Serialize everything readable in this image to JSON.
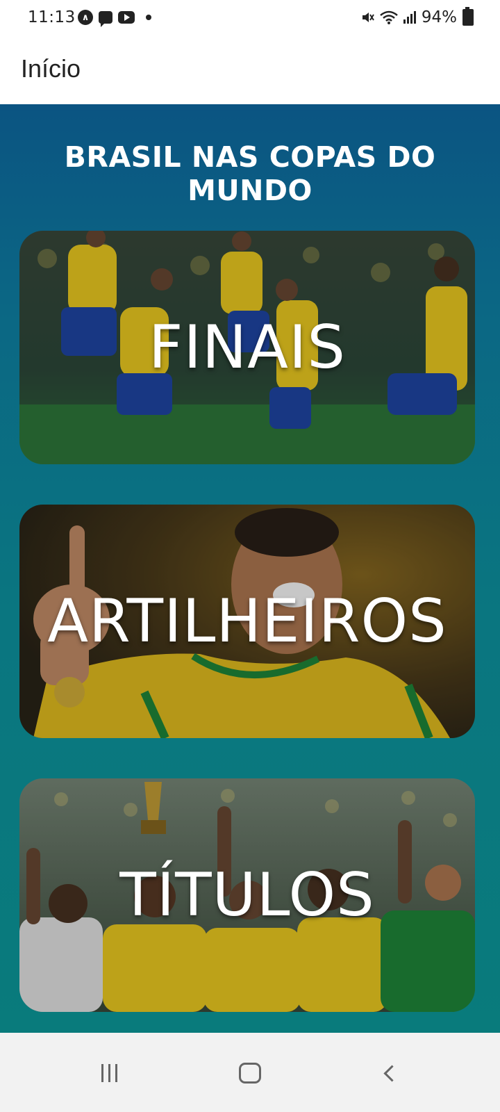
{
  "status_bar": {
    "time": "11:13",
    "notification_icons": [
      "assistant-icon",
      "message-icon",
      "youtube-icon",
      "dot-icon"
    ],
    "system_icons": [
      "mute-icon",
      "wifi-icon",
      "signal-icon"
    ],
    "battery": "94%"
  },
  "app_bar": {
    "title": "Início"
  },
  "main": {
    "heading": "BRASIL NAS COPAS DO MUNDO",
    "cards": [
      {
        "label": "FINAIS"
      },
      {
        "label": "ARTILHEIROS"
      },
      {
        "label": "TÍTULOS"
      }
    ]
  },
  "nav_bar": {
    "buttons": [
      "recents-icon",
      "home-icon",
      "back-icon"
    ]
  },
  "colors": {
    "gradient_top": "#0b5482",
    "gradient_bottom": "#097b7c",
    "brazil_yellow": "#f2d021",
    "brazil_blue": "#1f47a8",
    "brazil_green": "#1f8a3a"
  }
}
